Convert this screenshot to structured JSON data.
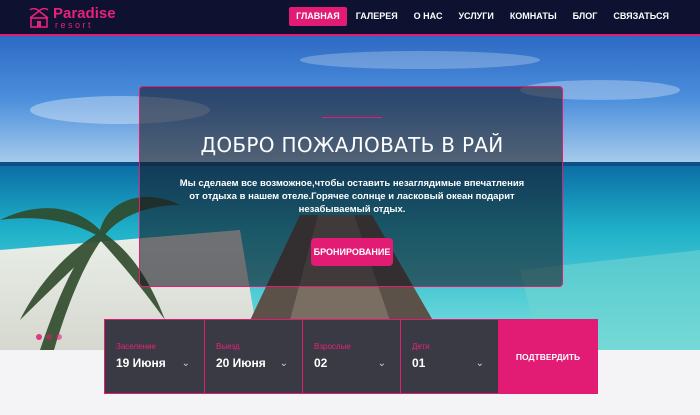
{
  "brand": {
    "name": "Paradise",
    "sub": "resort",
    "accent": "#e21b75",
    "header_bg": "#0e1130"
  },
  "nav": {
    "items": [
      {
        "label": "ГЛАВНАЯ",
        "active": true
      },
      {
        "label": "ГАЛЕРЕЯ"
      },
      {
        "label": "О НАС"
      },
      {
        "label": "УСЛУГИ"
      },
      {
        "label": "КОМНАТЫ"
      },
      {
        "label": "БЛОГ"
      },
      {
        "label": "СВЯЗАТЬСЯ"
      }
    ]
  },
  "hero": {
    "title": "ДОБРО ПОЖАЛОВАТЬ В РАЙ",
    "text": "Мы сделаем все возможное,чтобы оставить незаглядимые впечатления от отдыха в нашем отеле.Горячее солнце и ласковый океан подарит незабываемый отдых.",
    "button": "БРОНИРОВАНИЕ",
    "slide_count": 3
  },
  "booking": {
    "fields": [
      {
        "label": "Заселение",
        "value": "19 Июня"
      },
      {
        "label": "Выезд",
        "value": "20 Июня"
      },
      {
        "label": "Взрослые",
        "value": "02"
      },
      {
        "label": "Дети",
        "value": "01"
      }
    ],
    "submit": "ПОДТВЕРДИТЬ",
    "chevron_icon": "chevron-down-icon"
  }
}
